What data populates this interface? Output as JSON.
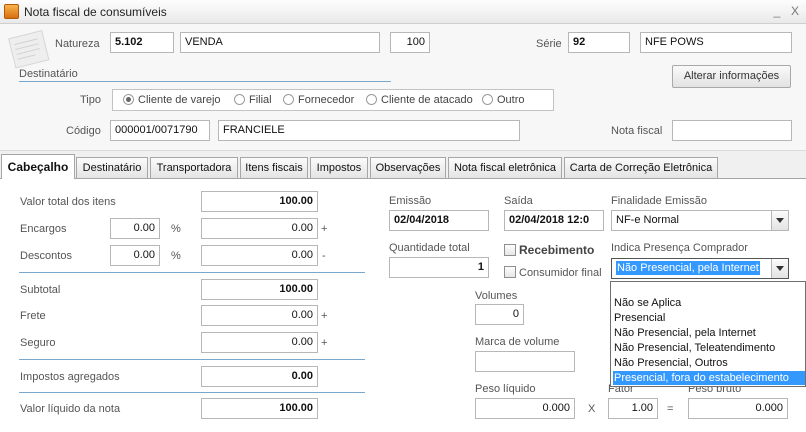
{
  "window": {
    "title": "Nota fiscal de consumíveis",
    "minimize": "_",
    "close": "X"
  },
  "header": {
    "natureza_label": "Natureza",
    "natureza_code": "5.102",
    "natureza_desc": "VENDA",
    "natureza_num": "100",
    "serie_label": "Série",
    "serie_value": "92",
    "serie_desc": "NFE POWS"
  },
  "destinatario": {
    "section_label": "Destinatário",
    "alterar_button": "Alterar informações",
    "tipo_label": "Tipo",
    "tipo_options": [
      "Cliente de varejo",
      "Filial",
      "Fornecedor",
      "Cliente de atacado",
      "Outro"
    ],
    "tipo_selected": 0,
    "codigo_label": "Código",
    "codigo_value": "000001/0071790",
    "nome_value": "FRANCIELE",
    "nota_fiscal_label": "Nota fiscal",
    "nota_fiscal_value": ""
  },
  "tabs": [
    "Cabeçalho",
    "Destinatário",
    "Transportadora",
    "Itens fiscais",
    "Impostos",
    "Observações",
    "Nota fiscal eletrônica",
    "Carta de Correção Eletrônica"
  ],
  "totals": {
    "valor_total_label": "Valor total dos itens",
    "valor_total_value": "100.00",
    "encargos_label": "Encargos",
    "encargos_pct": "0.00",
    "encargos_value": "0.00",
    "descontos_label": "Descontos",
    "descontos_pct": "0.00",
    "descontos_value": "0.00",
    "percent_sign": "%",
    "plus_sign": "+",
    "minus_sign": "-",
    "subtotal_label": "Subtotal",
    "subtotal_value": "100.00",
    "frete_label": "Frete",
    "frete_value": "0.00",
    "seguro_label": "Seguro",
    "seguro_value": "0.00",
    "impostos_label": "Impostos agregados",
    "impostos_value": "0.00",
    "valor_liquido_label": "Valor líquido da nota",
    "valor_liquido_value": "100.00"
  },
  "emissao": {
    "emissao_label": "Emissão",
    "emissao_value": "02/04/2018",
    "saida_label": "Saída",
    "saida_value": "02/04/2018 12:0",
    "quantidade_label": "Quantidade total",
    "quantidade_value": "1",
    "recebimento_label": "Recebimento",
    "consumidor_label": "Consumidor final",
    "volumes_label": "Volumes",
    "volumes_value": "0",
    "marca_label": "Marca de volume",
    "marca_value": "",
    "peso_liquido_label": "Peso líquido",
    "peso_liquido_value": "0.000",
    "times_sign": "X",
    "fator_label": "Fator",
    "fator_value": "1.00",
    "equals_sign": "=",
    "peso_bruto_label": "Peso bruto",
    "peso_bruto_value": "0.000"
  },
  "finalidade": {
    "label": "Finalidade Emissão",
    "value": "NF-e Normal"
  },
  "presenca": {
    "label": "Indica Presença Comprador",
    "value": "Não Presencial, pela Internet",
    "options": [
      "Não se Aplica",
      "Presencial",
      "Não Presencial, pela Internet",
      "Não Presencial, Teleatendimento",
      "Não Presencial, Outros",
      "Presencial, fora do estabelecimento"
    ],
    "highlighted": 5
  }
}
